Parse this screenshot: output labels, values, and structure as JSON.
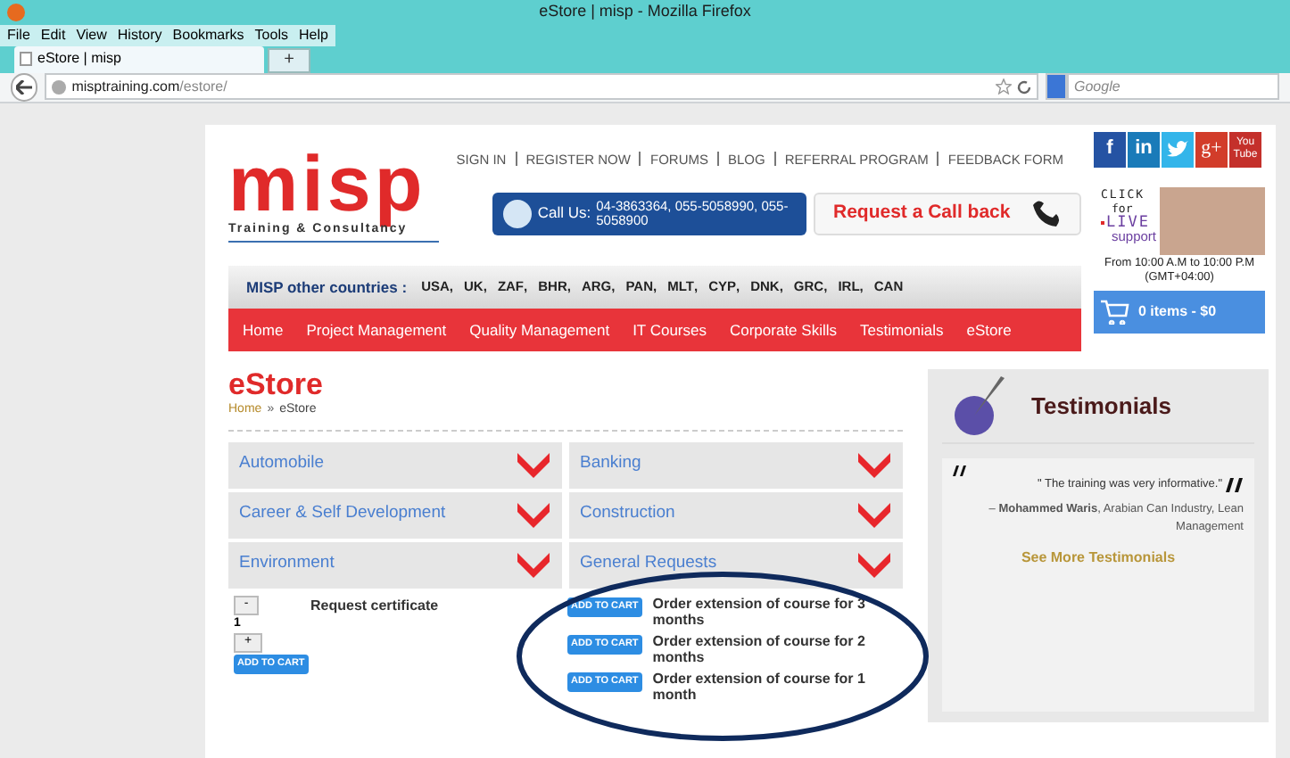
{
  "window": {
    "title": "eStore | misp - Mozilla Firefox"
  },
  "menu": [
    "File",
    "Edit",
    "View",
    "History",
    "Bookmarks",
    "Tools",
    "Help"
  ],
  "tabs": [
    {
      "label": "eStore | misp",
      "selected": true
    }
  ],
  "new_tab": "+",
  "address_bar": {
    "host": "misptraining.com",
    "path": "/estore/"
  },
  "search": {
    "placeholder": "Google"
  },
  "top_links": [
    "SIGN IN",
    "REGISTER NOW",
    "FORUMS",
    "BLOG",
    "REFERRAL PROGRAM",
    "FEEDBACK FORM"
  ],
  "logo": {
    "text": "misp",
    "tagline": "Training & Consultancy"
  },
  "call_us": {
    "label": "Call Us:",
    "numbers": "04-3863364, 055-5058990, 055-5058900"
  },
  "callback": "Request a Call back",
  "social": [
    {
      "kind": "facebook",
      "label": "f"
    },
    {
      "kind": "linkedin",
      "label": "in"
    },
    {
      "kind": "twitter"
    },
    {
      "kind": "googleplus",
      "label": "g+"
    },
    {
      "kind": "youtube",
      "label": "You Tube"
    }
  ],
  "live_support": {
    "line_1": "CLICK",
    "line_2": "for",
    "line_3": "LIVE",
    "line_4": "support",
    "hours": "From 10:00 A.M to 10:00 P.M",
    "timezone": "(GMT+04:00)"
  },
  "cart": "0 items - $0",
  "countries": {
    "label": "MISP other countries :",
    "separator": ",",
    "codes": [
      "USA",
      "UK",
      "ZAF",
      "BHR",
      "ARG",
      "PAN",
      "MLT",
      "CYP",
      "DNK",
      "GRC",
      "IRL",
      "CAN"
    ]
  },
  "nav": [
    "Home",
    "Project Management",
    "Quality Management",
    "IT Courses",
    "Corporate Skills",
    "Testimonials",
    "eStore"
  ],
  "page_title": "eStore",
  "breadcrumb": {
    "home": "Home",
    "separator": "»",
    "current": "eStore"
  },
  "categories": [
    "Automobile",
    "Banking",
    "Career & Self Development",
    "Construction",
    "Environment",
    "General Requests"
  ],
  "certificate": {
    "minus": "-",
    "quantity": "1",
    "plus": "+",
    "button": "ADD TO CART",
    "name": "Request certificate"
  },
  "products": [
    {
      "button": "ADD TO CART",
      "name": "Order extension of course for 3 months"
    },
    {
      "button": "ADD TO CART",
      "name": "Order extension of course for 2 months"
    },
    {
      "button": "ADD TO CART",
      "name": "Order extension of course for 1 month"
    }
  ],
  "testimonials": {
    "title": "Testimonials",
    "quote": "\" The training was very informative.\"",
    "author": "– **Mohammed Waris**, Arabian Can Industry, Lean Management",
    "link": "See More Testimonials"
  }
}
